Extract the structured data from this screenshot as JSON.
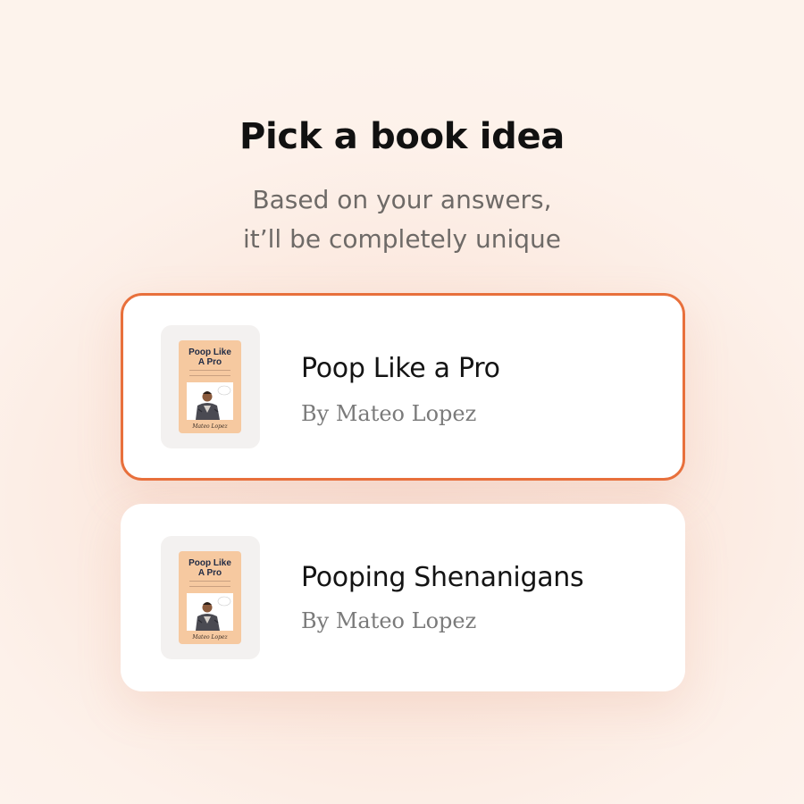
{
  "header": {
    "title": "Pick a book idea",
    "subtitle_line1": "Based on your answers,",
    "subtitle_line2": "it’ll be completely unique"
  },
  "options": [
    {
      "title": "Poop Like a Pro",
      "author": "By Mateo Lopez",
      "selected": true,
      "cover": {
        "title_line1": "Poop Like",
        "title_line2": "A Pro",
        "author": "Mateo Lopez",
        "background": "#f6c9a0"
      }
    },
    {
      "title": "Pooping Shenanigans",
      "author": "By Mateo Lopez",
      "selected": false,
      "cover": {
        "title_line1": "Poop Like",
        "title_line2": "A Pro",
        "author": "Mateo Lopez",
        "background": "#f6c9a0"
      }
    }
  ],
  "colors": {
    "accent": "#e8703c",
    "title": "#111111",
    "subtitle": "#6e6a67",
    "author": "#7a7a7a"
  }
}
